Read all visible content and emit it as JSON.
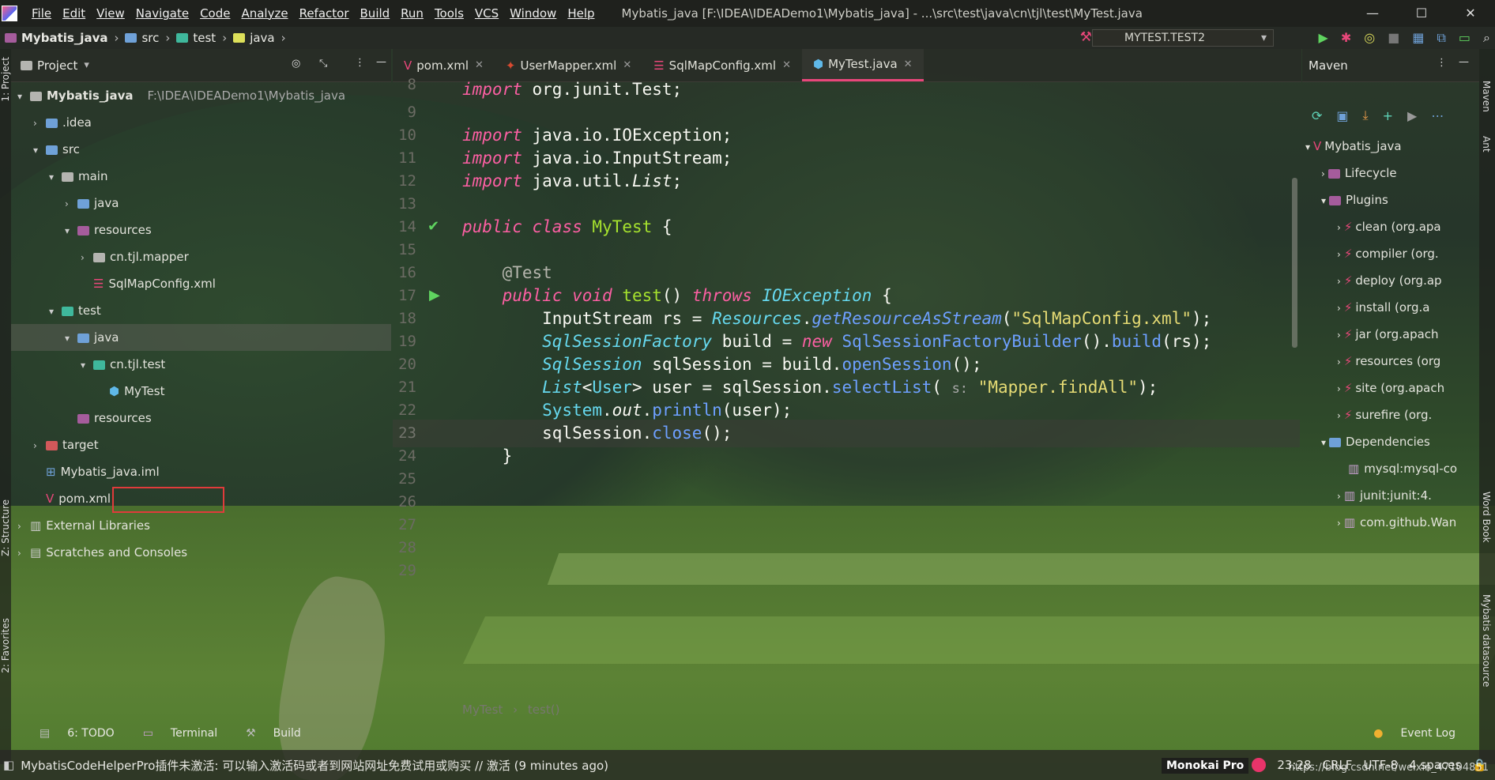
{
  "window": {
    "menu": [
      "File",
      "Edit",
      "View",
      "Navigate",
      "Code",
      "Analyze",
      "Refactor",
      "Build",
      "Run",
      "Tools",
      "VCS",
      "Window",
      "Help"
    ],
    "title": "Mybatis_java [F:\\IDEA\\IDEADemo1\\Mybatis_java] - ...\\src\\test\\java\\cn\\tjl\\test\\MyTest.java",
    "controls": [
      "—",
      "☐",
      "✕"
    ]
  },
  "nav": {
    "crumbs": [
      "Mybatis_java",
      "src",
      "test",
      "java"
    ],
    "run_config": "MYTEST.TEST2"
  },
  "project": {
    "header": "Project",
    "root": "Mybatis_java",
    "root_path": "F:\\IDEA\\IDEADemo1\\Mybatis_java",
    "items": [
      ".idea",
      "src",
      "main",
      "java",
      "resources",
      "cn.tjl.mapper",
      "SqlMapConfig.xml",
      "test",
      "java",
      "cn.tjl.test",
      "MyTest",
      "resources",
      "target",
      "Mybatis_java.iml",
      "pom.xml",
      "External Libraries",
      "Scratches and Consoles"
    ]
  },
  "tabs": [
    "pom.xml",
    "UserMapper.xml",
    "SqlMapConfig.xml",
    "MyTest.java"
  ],
  "editor": {
    "line_numbers": [
      "8",
      "9",
      "10",
      "11",
      "12",
      "13",
      "14",
      "15",
      "16",
      "17",
      "18",
      "19",
      "20",
      "21",
      "22",
      "23",
      "24",
      "25",
      "26",
      "27",
      "28",
      "29"
    ],
    "breadcrumb": [
      "MyTest",
      "test()"
    ]
  },
  "maven": {
    "header": "Maven",
    "items": [
      "Mybatis_java",
      "Lifecycle",
      "Plugins",
      "clean (org.apa",
      "compiler (org.",
      "deploy (org.ap",
      "install (org.a",
      "jar (org.apach",
      "resources (org",
      "site (org.apach",
      "surefire (org.",
      "Dependencies",
      "mysql:mysql-co",
      "junit:junit:4.",
      "com.github.Wan"
    ]
  },
  "side_labels": {
    "left": [
      "1: Project",
      "Z: Structure",
      "2: Favorites"
    ],
    "right": [
      "Maven",
      "Ant",
      "Word Book",
      "Mybatis datasource"
    ]
  },
  "toolwindows": [
    "6: TODO",
    "Terminal",
    "Build"
  ],
  "event_log": "Event Log",
  "status": {
    "message": "MybatisCodeHelperPro插件未激活: 可以输入激活码或者到网站网址免费试用或购买 // 激活 (9 minutes ago)",
    "theme": "Monokai Pro",
    "position": "23:28",
    "line_sep": "CRLF",
    "encoding": "UTF-8",
    "indent": "4 spaces",
    "watermark": "https://blog.csdn.net/weixin_47104851"
  }
}
